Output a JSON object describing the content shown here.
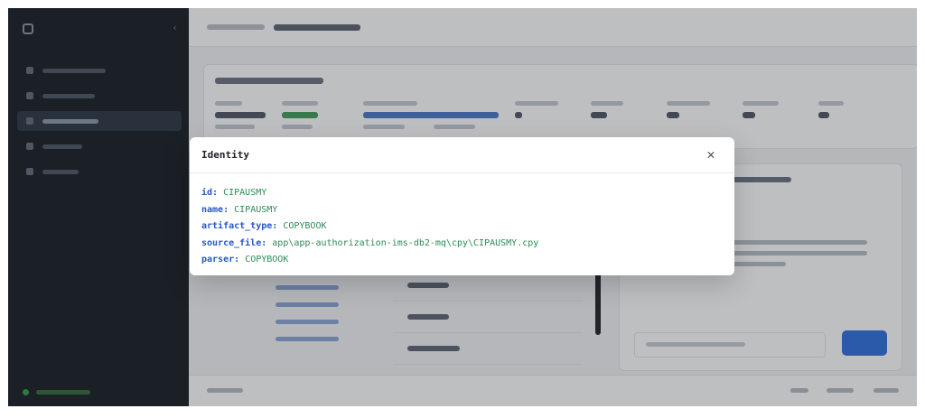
{
  "modal": {
    "title": "Identity",
    "close_icon": "close-icon",
    "fields": [
      {
        "key": "id:",
        "value": "CIPAUSMY"
      },
      {
        "key": "name:",
        "value": "CIPAUSMY"
      },
      {
        "key": "artifact_type:",
        "value": "COPYBOOK"
      },
      {
        "key": "source_file:",
        "value": "app\\app-authorization-ims-db2-mq\\cpy\\CIPAUSMY.cpy"
      },
      {
        "key": "parser:",
        "value": "COPYBOOK"
      }
    ]
  },
  "colors": {
    "key": "#2757c8",
    "value": "#2e8a57",
    "sidebar": "#161b22",
    "accent": "#2f6fe0"
  }
}
